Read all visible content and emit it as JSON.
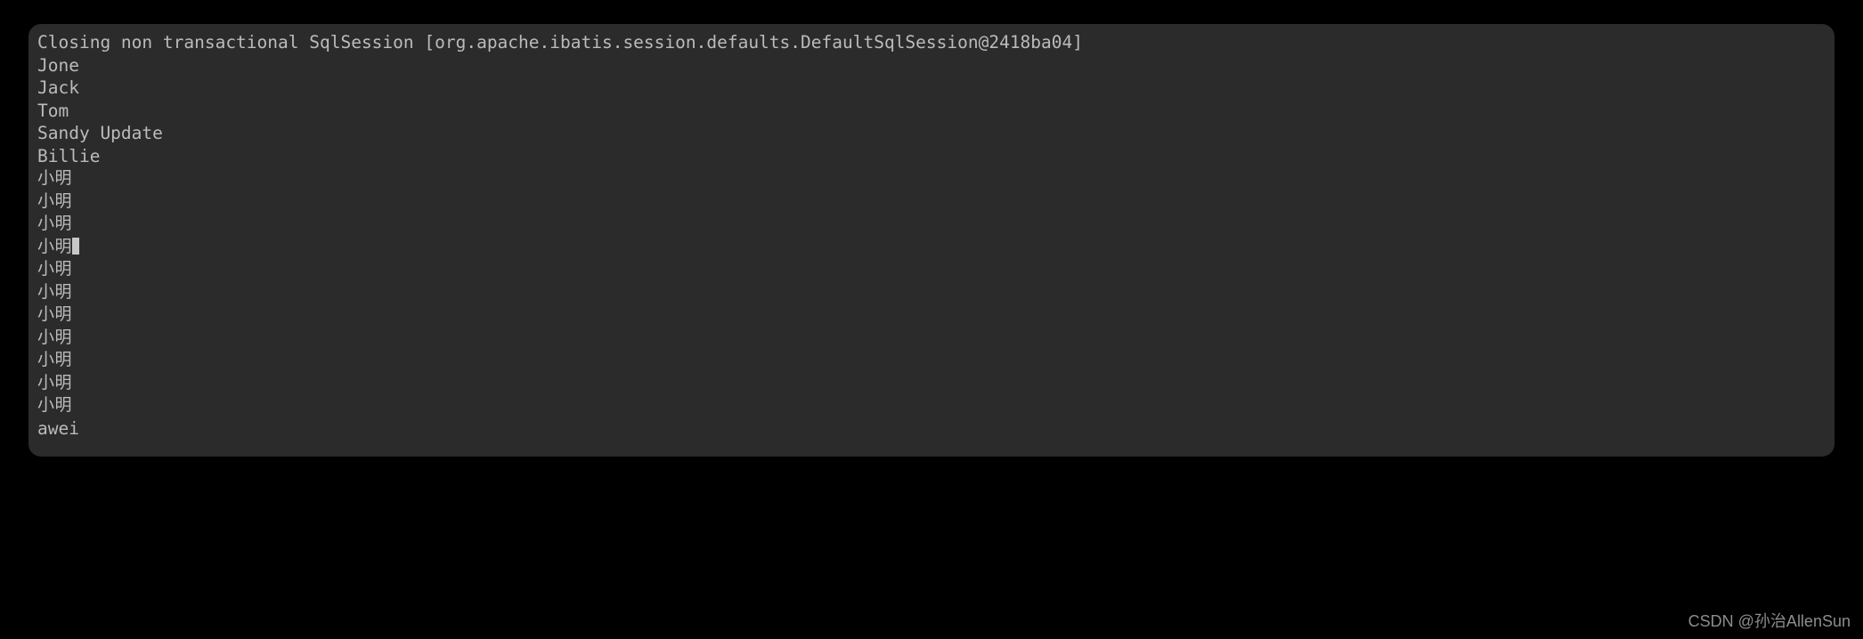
{
  "console": {
    "name": "run-console-output",
    "background_color": "#2b2b2b",
    "text_color": "#bbbbbb",
    "page_background": "#000000",
    "caret": {
      "visible": true,
      "line_index": 9,
      "color": "#c8c8c8"
    },
    "lines": [
      {
        "text": "Closing non transactional SqlSession [org.apache.ibatis.session.defaults.DefaultSqlSession@2418ba04]",
        "cjk": false,
        "caret": false
      },
      {
        "text": "Jone",
        "cjk": false,
        "caret": false
      },
      {
        "text": "Jack",
        "cjk": false,
        "caret": false
      },
      {
        "text": "Tom",
        "cjk": false,
        "caret": false
      },
      {
        "text": "Sandy Update",
        "cjk": false,
        "caret": false
      },
      {
        "text": "Billie",
        "cjk": false,
        "caret": false
      },
      {
        "text": "小明",
        "cjk": true,
        "caret": false
      },
      {
        "text": "小明",
        "cjk": true,
        "caret": false
      },
      {
        "text": "小明",
        "cjk": true,
        "caret": false
      },
      {
        "text": "小明",
        "cjk": true,
        "caret": true
      },
      {
        "text": "小明",
        "cjk": true,
        "caret": false
      },
      {
        "text": "小明",
        "cjk": true,
        "caret": false
      },
      {
        "text": "小明",
        "cjk": true,
        "caret": false
      },
      {
        "text": "小明",
        "cjk": true,
        "caret": false
      },
      {
        "text": "小明",
        "cjk": true,
        "caret": false
      },
      {
        "text": "小明",
        "cjk": true,
        "caret": false
      },
      {
        "text": "小明",
        "cjk": true,
        "caret": false
      },
      {
        "text": "awei",
        "cjk": false,
        "caret": false
      }
    ]
  },
  "watermark": {
    "text": "CSDN @孙治AllenSun",
    "color": "#8d8d8d"
  }
}
